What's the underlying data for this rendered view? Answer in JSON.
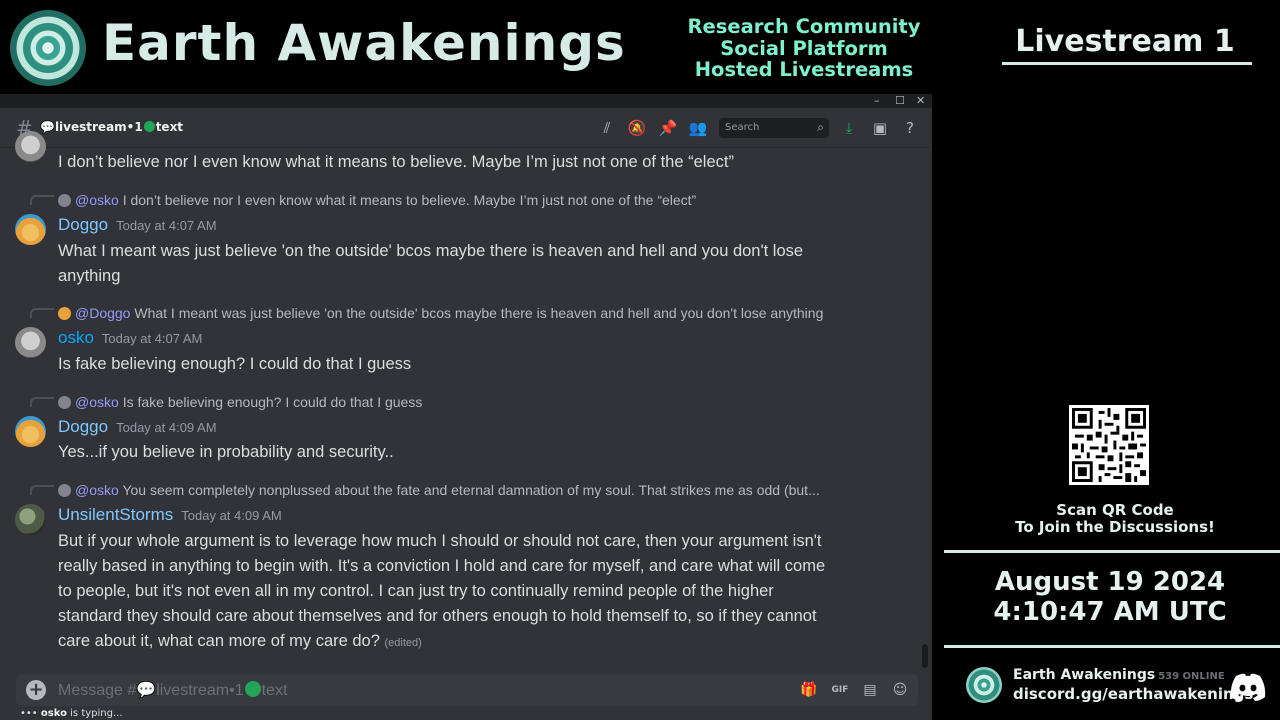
{
  "banner": {
    "brand": "Earth Awakenings",
    "taglines": [
      "Research Community",
      "Social Platform",
      "Hosted Livestreams"
    ]
  },
  "right_panel": {
    "title": "Livestream 1",
    "qr_line1": "Scan QR Code",
    "qr_line2": "To Join the Discussions!",
    "date": "August 19 2024",
    "time": "4:10:47 AM UTC",
    "server_name": "Earth Awakenings",
    "server_online": "539 ONLINE",
    "invite": "discord.gg/earthawakenings"
  },
  "window": {
    "controls": [
      "–",
      "☐",
      "✕"
    ]
  },
  "channel": {
    "name_prefix": "💬livestream•1",
    "name_suffix": "text",
    "search_placeholder": "Search"
  },
  "messages": {
    "m0": {
      "text": "I don’t believe nor I even know what it means to believe. Maybe I’m just not one of the “elect”"
    },
    "m1": {
      "reply_mention": "@osko",
      "reply_text": "I don’t believe nor I even know what it means to believe. Maybe I’m just not one of the “elect”",
      "author": "Doggo",
      "timestamp": "Today at 4:07 AM",
      "line1": "What I meant was just believe 'on the outside' bcos maybe there is heaven and hell and you don't lose",
      "line2": "anything"
    },
    "m2": {
      "reply_mention": "@Doggo",
      "reply_text": "What I meant was just believe 'on the outside' bcos maybe there is heaven and hell and you don't lose anything",
      "author": "osko",
      "timestamp": "Today at 4:07 AM",
      "line1": "Is fake believing enough? I could do that I guess"
    },
    "m3": {
      "reply_mention": "@osko",
      "reply_text": "Is fake believing enough? I could do that I guess",
      "author": "Doggo",
      "timestamp": "Today at 4:09 AM",
      "line1": "Yes...if you believe in probability and security.."
    },
    "m4": {
      "reply_mention": "@osko",
      "reply_text": "You seem completely nonplussed about the fate and eternal damnation of my soul. That strikes me as odd (but...",
      "author": "UnsilentStorms",
      "timestamp": "Today at 4:09 AM",
      "line1": "But if your whole argument is to leverage how much I should or should not care, then your argument isn't",
      "line2": "really based in anything to begin with. It's a conviction I hold and care for myself, and care what will come",
      "line3": "to people, but it's not even all in my control. I can just try to continually remind people of the higher",
      "line4": "standard they should care about themselves and for others enough to hold themself to, so if they cannot",
      "line5": "care about it, what can more of my care do?",
      "edited": "(edited)"
    }
  },
  "composer": {
    "placeholder_prefix": "Message #💬livestream•1",
    "placeholder_suffix": "text",
    "typing_user": "osko",
    "typing_suffix": " is typing..."
  }
}
